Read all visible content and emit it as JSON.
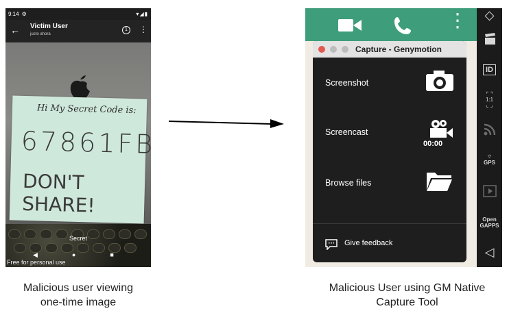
{
  "left_phone": {
    "status_time": "9:14",
    "contact_name": "Victim User",
    "contact_status": "justo ahora",
    "timer_label": "1",
    "note_line1": "Hi My Secret Code is:",
    "note_code": "67861FB",
    "note_warning": "DON'T SHARE!",
    "photo_caption": "Secret",
    "watermark": "Free for personal use",
    "icons": [
      "back-arrow-icon",
      "timer-icon",
      "kebab-menu-icon",
      "apple-logo-icon"
    ]
  },
  "emulator": {
    "capture_window": {
      "title": "Capture - Genymotion",
      "items": [
        {
          "label": "Screenshot",
          "icon": "camera-icon"
        },
        {
          "label": "Screencast",
          "icon": "video-camera-icon",
          "icon_text": "00:00"
        },
        {
          "label": "Browse files",
          "icon": "folder-icon"
        }
      ],
      "feedback_label": "Give feedback"
    },
    "toolbar": {
      "id_label": "ID",
      "pixel_label": "1:1",
      "gps_label": "GPS",
      "opengapps_label": "Open GAPPS"
    },
    "accent_color": "#3e9e7c"
  },
  "captions": {
    "left": "Malicious user viewing\none-time image",
    "right": "Malicious User using GM Native\nCapture Tool"
  }
}
